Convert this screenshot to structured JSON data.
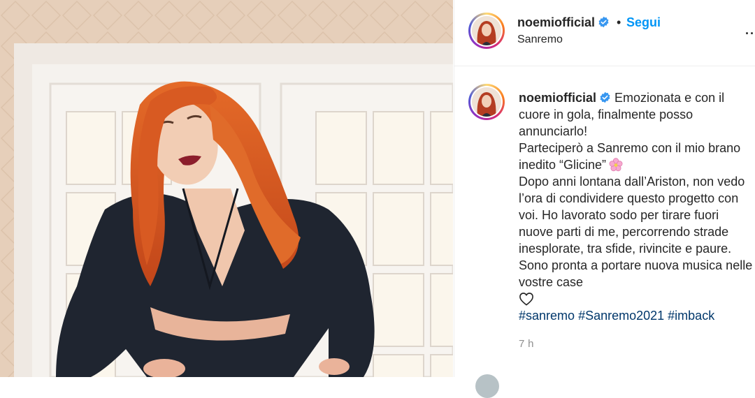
{
  "post": {
    "username": "noemiofficial",
    "location": "Sanremo",
    "separator": "•",
    "follow_label": "Segui",
    "more_label": "···"
  },
  "caption": {
    "username": "noemiofficial",
    "line1": "Emozionata e con il cuore in gola, finalmente posso annunciarlo!",
    "line2": "Parteciperò a Sanremo con il mio brano inedito “Glicine”",
    "line3": "Dopo anni lontana dall’Ariston, non vedo l’ora di condividere questo progetto con voi. Ho lavorato sodo per tirare fuori nuove parti di me, percorrendo strade inesplorate, tra sfide, rivincite e paure. Sono pronta a portare nuova musica nelle vostre case",
    "hashtags": [
      "#sanremo",
      "#Sanremo2021",
      "#imback"
    ],
    "time": "7 h"
  },
  "icons": {
    "verified": "verified-badge-icon",
    "flower": "cherry-blossom-emoji",
    "heart": "white-heart-emoji",
    "more": "more-options-icon"
  },
  "colors": {
    "link": "#0095f6",
    "hashtag": "#00376b",
    "verified": "#3897f0",
    "muted": "#8e8e8e",
    "hair": "#d9531b",
    "jacket": "#1f2530"
  }
}
